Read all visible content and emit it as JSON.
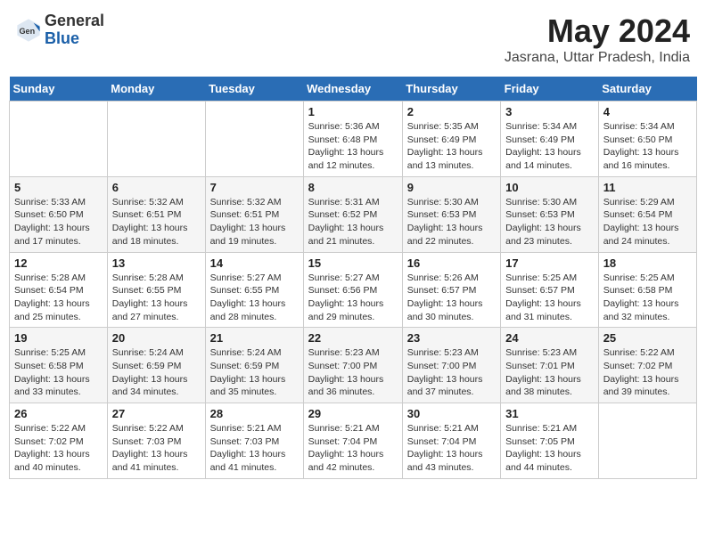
{
  "header": {
    "logo_general": "General",
    "logo_blue": "Blue",
    "month_year": "May 2024",
    "location": "Jasrana, Uttar Pradesh, India"
  },
  "days_of_week": [
    "Sunday",
    "Monday",
    "Tuesday",
    "Wednesday",
    "Thursday",
    "Friday",
    "Saturday"
  ],
  "weeks": [
    [
      {
        "day": "",
        "info": ""
      },
      {
        "day": "",
        "info": ""
      },
      {
        "day": "",
        "info": ""
      },
      {
        "day": "1",
        "info": "Sunrise: 5:36 AM\nSunset: 6:48 PM\nDaylight: 13 hours\nand 12 minutes."
      },
      {
        "day": "2",
        "info": "Sunrise: 5:35 AM\nSunset: 6:49 PM\nDaylight: 13 hours\nand 13 minutes."
      },
      {
        "day": "3",
        "info": "Sunrise: 5:34 AM\nSunset: 6:49 PM\nDaylight: 13 hours\nand 14 minutes."
      },
      {
        "day": "4",
        "info": "Sunrise: 5:34 AM\nSunset: 6:50 PM\nDaylight: 13 hours\nand 16 minutes."
      }
    ],
    [
      {
        "day": "5",
        "info": "Sunrise: 5:33 AM\nSunset: 6:50 PM\nDaylight: 13 hours\nand 17 minutes."
      },
      {
        "day": "6",
        "info": "Sunrise: 5:32 AM\nSunset: 6:51 PM\nDaylight: 13 hours\nand 18 minutes."
      },
      {
        "day": "7",
        "info": "Sunrise: 5:32 AM\nSunset: 6:51 PM\nDaylight: 13 hours\nand 19 minutes."
      },
      {
        "day": "8",
        "info": "Sunrise: 5:31 AM\nSunset: 6:52 PM\nDaylight: 13 hours\nand 21 minutes."
      },
      {
        "day": "9",
        "info": "Sunrise: 5:30 AM\nSunset: 6:53 PM\nDaylight: 13 hours\nand 22 minutes."
      },
      {
        "day": "10",
        "info": "Sunrise: 5:30 AM\nSunset: 6:53 PM\nDaylight: 13 hours\nand 23 minutes."
      },
      {
        "day": "11",
        "info": "Sunrise: 5:29 AM\nSunset: 6:54 PM\nDaylight: 13 hours\nand 24 minutes."
      }
    ],
    [
      {
        "day": "12",
        "info": "Sunrise: 5:28 AM\nSunset: 6:54 PM\nDaylight: 13 hours\nand 25 minutes."
      },
      {
        "day": "13",
        "info": "Sunrise: 5:28 AM\nSunset: 6:55 PM\nDaylight: 13 hours\nand 27 minutes."
      },
      {
        "day": "14",
        "info": "Sunrise: 5:27 AM\nSunset: 6:55 PM\nDaylight: 13 hours\nand 28 minutes."
      },
      {
        "day": "15",
        "info": "Sunrise: 5:27 AM\nSunset: 6:56 PM\nDaylight: 13 hours\nand 29 minutes."
      },
      {
        "day": "16",
        "info": "Sunrise: 5:26 AM\nSunset: 6:57 PM\nDaylight: 13 hours\nand 30 minutes."
      },
      {
        "day": "17",
        "info": "Sunrise: 5:25 AM\nSunset: 6:57 PM\nDaylight: 13 hours\nand 31 minutes."
      },
      {
        "day": "18",
        "info": "Sunrise: 5:25 AM\nSunset: 6:58 PM\nDaylight: 13 hours\nand 32 minutes."
      }
    ],
    [
      {
        "day": "19",
        "info": "Sunrise: 5:25 AM\nSunset: 6:58 PM\nDaylight: 13 hours\nand 33 minutes."
      },
      {
        "day": "20",
        "info": "Sunrise: 5:24 AM\nSunset: 6:59 PM\nDaylight: 13 hours\nand 34 minutes."
      },
      {
        "day": "21",
        "info": "Sunrise: 5:24 AM\nSunset: 6:59 PM\nDaylight: 13 hours\nand 35 minutes."
      },
      {
        "day": "22",
        "info": "Sunrise: 5:23 AM\nSunset: 7:00 PM\nDaylight: 13 hours\nand 36 minutes."
      },
      {
        "day": "23",
        "info": "Sunrise: 5:23 AM\nSunset: 7:00 PM\nDaylight: 13 hours\nand 37 minutes."
      },
      {
        "day": "24",
        "info": "Sunrise: 5:23 AM\nSunset: 7:01 PM\nDaylight: 13 hours\nand 38 minutes."
      },
      {
        "day": "25",
        "info": "Sunrise: 5:22 AM\nSunset: 7:02 PM\nDaylight: 13 hours\nand 39 minutes."
      }
    ],
    [
      {
        "day": "26",
        "info": "Sunrise: 5:22 AM\nSunset: 7:02 PM\nDaylight: 13 hours\nand 40 minutes."
      },
      {
        "day": "27",
        "info": "Sunrise: 5:22 AM\nSunset: 7:03 PM\nDaylight: 13 hours\nand 41 minutes."
      },
      {
        "day": "28",
        "info": "Sunrise: 5:21 AM\nSunset: 7:03 PM\nDaylight: 13 hours\nand 41 minutes."
      },
      {
        "day": "29",
        "info": "Sunrise: 5:21 AM\nSunset: 7:04 PM\nDaylight: 13 hours\nand 42 minutes."
      },
      {
        "day": "30",
        "info": "Sunrise: 5:21 AM\nSunset: 7:04 PM\nDaylight: 13 hours\nand 43 minutes."
      },
      {
        "day": "31",
        "info": "Sunrise: 5:21 AM\nSunset: 7:05 PM\nDaylight: 13 hours\nand 44 minutes."
      },
      {
        "day": "",
        "info": ""
      }
    ]
  ]
}
